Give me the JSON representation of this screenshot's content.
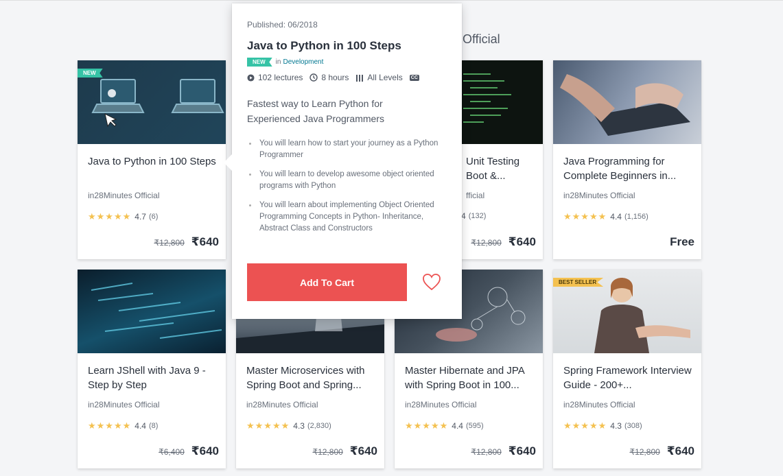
{
  "section": {
    "title_fragment": "Official"
  },
  "popover": {
    "published": "Published: 06/2018",
    "title": "Java to Python in 100 Steps",
    "badge": "NEW",
    "category_prefix": "in",
    "category": "Development",
    "lectures": "102 lectures",
    "hours": "8 hours",
    "level": "All Levels",
    "cc": "CC",
    "description": "Fastest way to Learn Python for Experienced Java Programmers",
    "objectives": [
      "You will learn how to start your journey as a Python Programmer",
      "You will learn to develop awesome object oriented programs with Python",
      "You will learn about implementing Object Oriented Programming Concepts in Python- Inheritance, Abstract Class and Constructors"
    ],
    "add_to_cart": "Add To Cart"
  },
  "courses": [
    {
      "title": "Java to Python in 100 Steps",
      "author": "in28Minutes Official",
      "stars": "★★★★★",
      "rating": "4.7",
      "count": "(6)",
      "old_price": "₹12,800",
      "price": "₹640",
      "badge": "NEW"
    },
    {
      "title": "",
      "author": "",
      "stars": "",
      "rating": "",
      "count": "",
      "old_price": "",
      "price": ""
    },
    {
      "title": "Unit Testing Boot &...",
      "author": "fficial",
      "stars": "",
      "rating": "4",
      "count": "(132)",
      "old_price": "₹12,800",
      "price": "₹640"
    },
    {
      "title": "Java Programming for Complete Beginners in...",
      "author": "in28Minutes Official",
      "stars": "★★★★★",
      "rating": "4.4",
      "count": "(1,156)",
      "old_price": "",
      "price": "Free"
    },
    {
      "title": "Learn JShell with Java 9 - Step by Step",
      "author": "in28Minutes Official",
      "stars": "★★★★★",
      "rating": "4.4",
      "count": "(8)",
      "old_price": "₹6,400",
      "price": "₹640"
    },
    {
      "title": "Master Microservices with Spring Boot and Spring...",
      "author": "in28Minutes Official",
      "stars": "★★★★★",
      "rating": "4.3",
      "count": "(2,830)",
      "old_price": "₹12,800",
      "price": "₹640"
    },
    {
      "title": "Master Hibernate and JPA with Spring Boot in 100...",
      "author": "in28Minutes Official",
      "stars": "★★★★★",
      "rating": "4.4",
      "count": "(595)",
      "old_price": "₹12,800",
      "price": "₹640"
    },
    {
      "title": "Spring Framework Interview Guide - 200+...",
      "author": "in28Minutes Official",
      "stars": "★★★★★",
      "rating": "4.3",
      "count": "(308)",
      "old_price": "₹12,800",
      "price": "₹640",
      "badge": "BEST SELLER"
    }
  ],
  "colors": {
    "accent": "#ec5252",
    "star": "#f4c150",
    "new_badge": "#36c3a6",
    "best_badge": "#f4c150",
    "link": "#007791"
  }
}
